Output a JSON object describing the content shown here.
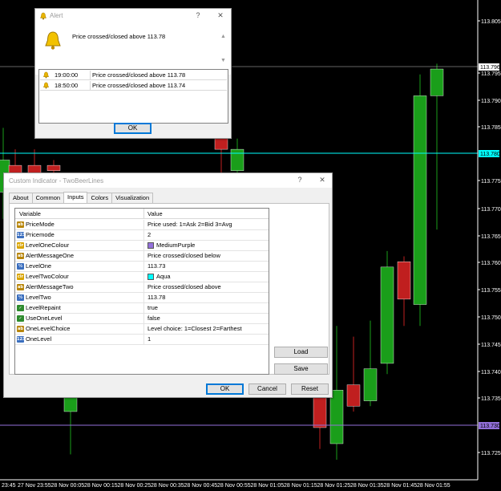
{
  "chart": {
    "price_labels": [
      "113.805",
      "113.796",
      "113.795",
      "113.790",
      "113.785",
      "113.780",
      "113.775",
      "113.770",
      "113.765",
      "113.760",
      "113.755",
      "113.750",
      "113.745",
      "113.740",
      "113.735",
      "113.730",
      "113.725"
    ],
    "time_labels": [
      "23:45",
      "27 Nov 23:55",
      "28 Nov 00:05",
      "28 Nov 00:15",
      "28 Nov 00:25",
      "28 Nov 00:35",
      "28 Nov 00:45",
      "28 Nov 00:55",
      "28 Nov 01:05",
      "28 Nov 01:15",
      "28 Nov 01:25",
      "28 Nov 01:35",
      "28 Nov 01:45",
      "28 Nov 01:55"
    ],
    "hline_aqua_label": "113.780",
    "hline_purple_label": "113.730",
    "bid_label": "113.796",
    "colors": {
      "up": "#1a9e1a",
      "down": "#c01f1f",
      "aqua": "#00ffff",
      "purple": "#9370db",
      "grid": "#ffffff"
    }
  },
  "alert": {
    "title": "Alert",
    "help_label": "?",
    "close_label": "✕",
    "message": "Price crossed/closed above 113.78",
    "rows": [
      {
        "time": "19:00:00",
        "message": "Price crossed/closed above 113.78"
      },
      {
        "time": "18:50:00",
        "message": "Price crossed/closed above 113.74"
      }
    ],
    "ok_label": "OK"
  },
  "indicator": {
    "title": "Custom Indicator - TwoBeerLines",
    "help_label": "?",
    "close_label": "✕",
    "tabs": [
      "About",
      "Common",
      "Inputs",
      "Colors",
      "Visualization"
    ],
    "active_tab": "Inputs",
    "col_variable": "Variable",
    "col_value": "Value",
    "rows": [
      {
        "icon": "ab",
        "icon_color": "#b8860b",
        "var": "PriceMode",
        "value": "Price used: 1=Ask 2=Bid 3=Avg"
      },
      {
        "icon": "123",
        "icon_color": "#3b6fbf",
        "var": "Pricemode",
        "value": "2"
      },
      {
        "icon": "clr",
        "icon_color": "#d9a400",
        "var": "LevelOneColour",
        "value": "MediumPurple",
        "swatch": "#9370db"
      },
      {
        "icon": "ab",
        "icon_color": "#b8860b",
        "var": "AlertMessageOne",
        "value": "Price crossed/closed below"
      },
      {
        "icon": "½",
        "icon_color": "#3b6fbf",
        "var": "LevelOne",
        "value": "113.73"
      },
      {
        "icon": "clr",
        "icon_color": "#d9a400",
        "var": "LevelTwoColour",
        "value": "Aqua",
        "swatch": "#00ffff"
      },
      {
        "icon": "ab",
        "icon_color": "#b8860b",
        "var": "AlertMessageTwo",
        "value": "Price crossed/closed above"
      },
      {
        "icon": "½",
        "icon_color": "#3b6fbf",
        "var": "LevelTwo",
        "value": "113.78"
      },
      {
        "icon": "✓",
        "icon_color": "#2e8b2e",
        "var": "LevelRepaint",
        "value": "true"
      },
      {
        "icon": "✓",
        "icon_color": "#2e8b2e",
        "var": "UseOneLevel",
        "value": "false"
      },
      {
        "icon": "ab",
        "icon_color": "#b8860b",
        "var": "OneLevelChoice",
        "value": "Level choice: 1=Closest 2=Farthest"
      },
      {
        "icon": "123",
        "icon_color": "#3b6fbf",
        "var": "OneLevel",
        "value": "1"
      }
    ],
    "load_label": "Load",
    "save_label": "Save",
    "ok_label": "OK",
    "cancel_label": "Cancel",
    "reset_label": "Reset"
  }
}
